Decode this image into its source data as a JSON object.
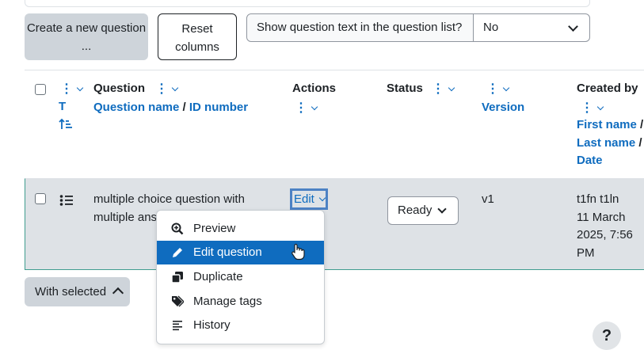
{
  "toolbar": {
    "create_label": "Create a new question ...",
    "reset_label": "Reset columns",
    "show_text_label": "Show question text in the question list?",
    "show_text_value": "No"
  },
  "table": {
    "headers": {
      "type_short": "T",
      "question": "Question",
      "question_name": "Question name",
      "separator": " / ",
      "id_number": "ID number",
      "actions": "Actions",
      "status": "Status",
      "version": "Version",
      "created_by": "Created by",
      "first_name": "First name",
      "last_name": "Last name",
      "date": "Date"
    },
    "rows": [
      {
        "question_line1": "multiple choice question with",
        "question_line2": "multiple ans",
        "action_label": "Edit",
        "status": "Ready",
        "version": "v1",
        "creator_line1": "t1fn t1ln",
        "creator_line2": "11 March",
        "creator_line3": "2025, 7:56",
        "creator_line4": "PM"
      }
    ]
  },
  "actions_menu": {
    "items": [
      {
        "label": "Preview",
        "icon": "magnifier-plus-icon"
      },
      {
        "label": "Edit question",
        "icon": "pencil-icon",
        "active": true
      },
      {
        "label": "Duplicate",
        "icon": "duplicate-icon"
      },
      {
        "label": "Manage tags",
        "icon": "tag-icon"
      },
      {
        "label": "History",
        "icon": "history-lines-icon"
      }
    ]
  },
  "footer": {
    "with_selected_label": "With selected",
    "help_label": "?"
  },
  "colors": {
    "link": "#0f6cbf",
    "button_grey": "#ced4da",
    "row_highlight": "#dee2e6",
    "menu_active": "#0f6cbf",
    "row_border": "#3f9c8f"
  }
}
